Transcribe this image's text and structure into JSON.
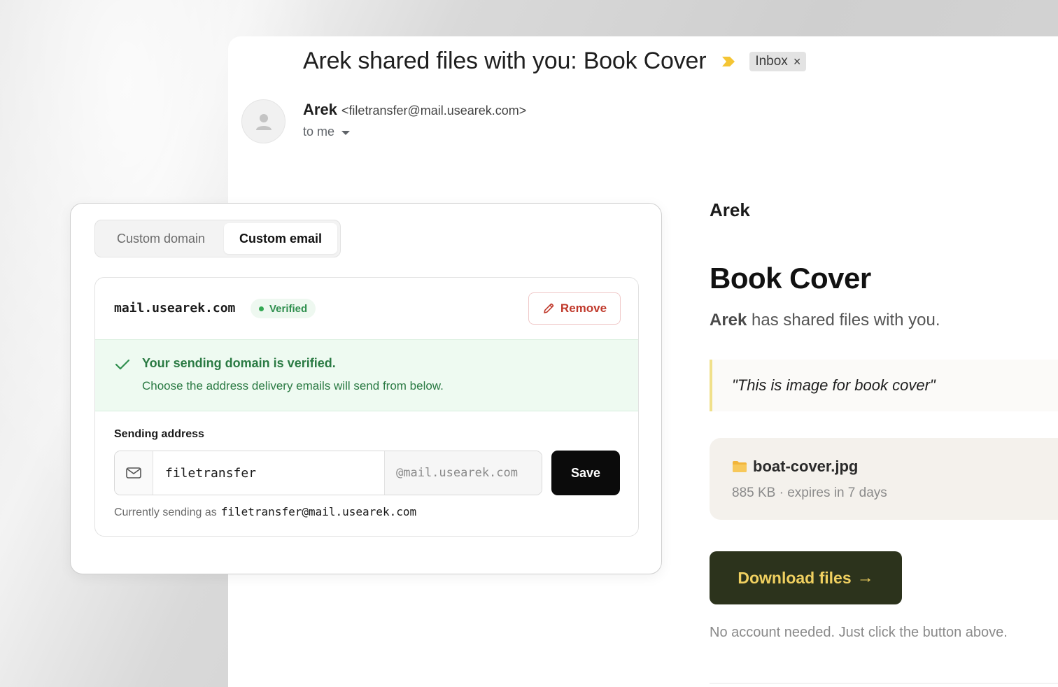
{
  "email": {
    "subject": "Arek shared files with you: Book Cover",
    "label_chip": "Inbox",
    "label_chip_close": "×",
    "sender_name": "Arek",
    "sender_email": "<filetransfer@mail.usearek.com>",
    "recipient": "to me",
    "body": {
      "brand": "Arek",
      "title": "Book Cover",
      "sub_name": "Arek",
      "sub_text": " has shared files with you.",
      "quote": "\"This is image for book cover\"",
      "file_name": "boat-cover.jpg",
      "file_meta": "885 KB · expires in 7 days",
      "download_label": "Download files",
      "download_arrow": "→",
      "footer_note": "No account needed. Just click the button above."
    }
  },
  "settings": {
    "tabs": [
      {
        "label": "Custom domain",
        "active": false
      },
      {
        "label": "Custom email",
        "active": true
      }
    ],
    "domain": "mail.usearek.com",
    "status": "Verified",
    "remove_label": "Remove",
    "alert_title": "Your sending domain is verified.",
    "alert_text": "Choose the address delivery emails will send from below.",
    "field_label": "Sending address",
    "local_part_value": "filetransfer",
    "domain_suffix": "@mail.usearek.com",
    "save_label": "Save",
    "current_prefix": "Currently sending as",
    "current_address": "filetransfer@mail.usearek.com"
  },
  "colors": {
    "accent_download_bg": "#2c331c",
    "accent_download_text": "#f0d060",
    "verified_green": "#2f8f4e",
    "remove_red": "#c0392b",
    "quote_bar": "#f0e08a"
  },
  "icons": {
    "importance": "importance-marker-icon",
    "avatar": "person-icon",
    "dropdown": "caret-down-icon",
    "folder": "folder-icon",
    "pencil": "pencil-icon",
    "check": "check-icon",
    "mail": "mail-icon"
  }
}
